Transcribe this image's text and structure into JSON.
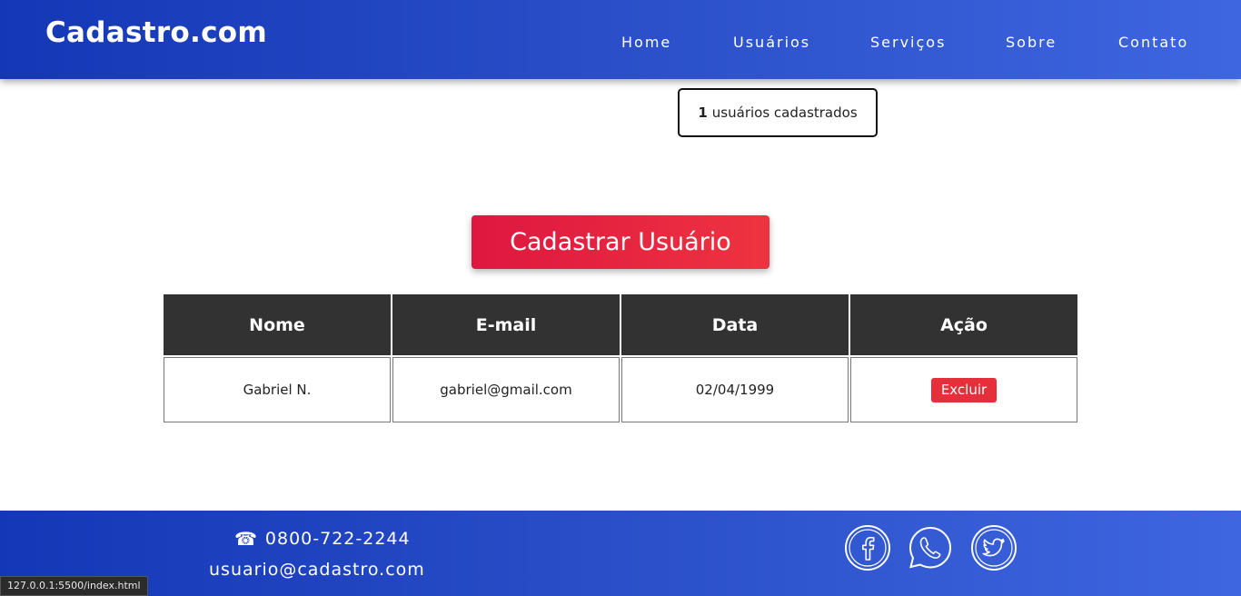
{
  "header": {
    "logo": "Cadastro.com",
    "nav": [
      "Home",
      "Usuários",
      "Serviços",
      "Sobre",
      "Contato"
    ]
  },
  "count": {
    "value": "1",
    "text": "usuários cadastrados"
  },
  "cadastrar_label": "Cadastrar Usuário",
  "table": {
    "headers": [
      "Nome",
      "E-mail",
      "Data",
      "Ação"
    ],
    "rows": [
      {
        "nome": "Gabriel N.",
        "email": "gabriel@gmail.com",
        "data": "02/04/1999",
        "acao": "Excluir"
      }
    ]
  },
  "footer": {
    "phone": "0800-722-2244",
    "email": "usuario@cadastro.com",
    "social_icons": [
      "facebook-icon",
      "whatsapp-icon",
      "twitter-icon"
    ]
  },
  "statusbar": "127.0.0.1:5500/index.html",
  "colors": {
    "header_start": "#1437b7",
    "header_end": "#3e66e0",
    "accent_red": "#e5303b",
    "table_header": "#323232"
  }
}
